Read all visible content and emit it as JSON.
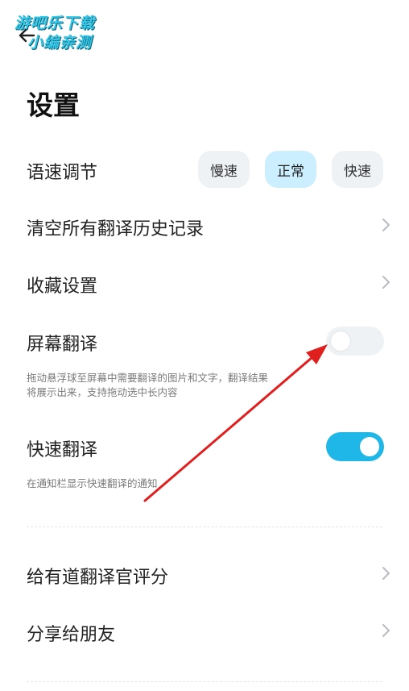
{
  "watermark": {
    "line1": "游吧乐下载",
    "line2": "小编亲测"
  },
  "header": {
    "back_icon": "back-arrow-icon",
    "title": "设置"
  },
  "speed": {
    "label": "语速调节",
    "options": [
      "慢速",
      "正常",
      "快速"
    ],
    "selected": "正常"
  },
  "rows": {
    "clear_history": "清空所有翻译历史记录",
    "favorites": "收藏设置",
    "rate": "给有道翻译官评分",
    "share": "分享给朋友"
  },
  "screen_translate": {
    "label": "屏幕翻译",
    "desc_line1": "拖动悬浮球至屏幕中需要翻译的图片和文字，翻译结果",
    "desc_line2": "将展示出来，支持拖动选中长内容",
    "enabled": false
  },
  "quick_translate": {
    "label": "快速翻译",
    "desc": "在通知栏显示快速翻译的通知",
    "enabled": true
  },
  "colors": {
    "accent": "#1fb6e8",
    "selected_chip": "#ccefff",
    "annotation_arrow": "#e01f1f"
  }
}
